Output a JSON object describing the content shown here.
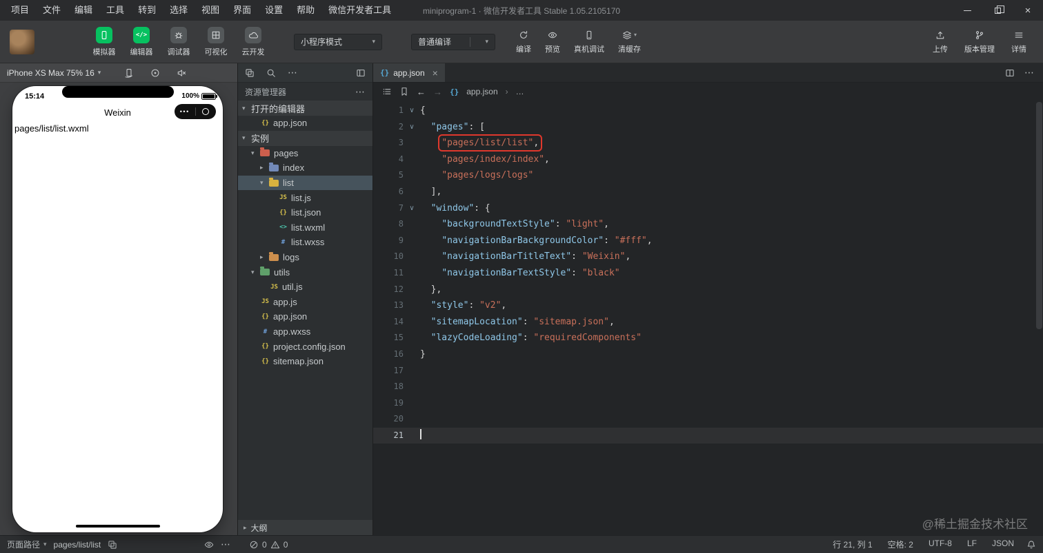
{
  "colors": {
    "accent_green": "#07c160",
    "highlight_red": "#e0382c",
    "json_key": "#8fc7e8",
    "json_string": "#c9705a",
    "tree_selection": "#46535c"
  },
  "menubar": {
    "items": [
      "项目",
      "文件",
      "编辑",
      "工具",
      "转到",
      "选择",
      "视图",
      "界面",
      "设置",
      "帮助",
      "微信开发者工具"
    ],
    "title": "miniprogram-1 · 微信开发者工具 Stable 1.05.2105170"
  },
  "toolbar": {
    "mode_buttons": [
      {
        "label": "模拟器",
        "name": "simulator-toggle-button",
        "icon": "phone-icon",
        "style": "green"
      },
      {
        "label": "编辑器",
        "name": "editor-toggle-button",
        "icon": "code-glyph",
        "style": "green"
      },
      {
        "label": "调试器",
        "name": "debugger-toggle-button",
        "icon": "bug-icon",
        "style": "gray"
      },
      {
        "label": "可视化",
        "name": "visualizer-toggle-button",
        "icon": "grid-icon",
        "style": "gray"
      },
      {
        "label": "云开发",
        "name": "cloud-dev-button",
        "icon": "cloud-icon",
        "style": "gray"
      }
    ],
    "mode_select": {
      "value": "小程序模式"
    },
    "compile_select": {
      "value": "普通编译"
    },
    "action_buttons": [
      {
        "label": "编译",
        "name": "compile-button",
        "icon": "refresh-icon"
      },
      {
        "label": "预览",
        "name": "preview-button",
        "icon": "eye-icon"
      },
      {
        "label": "真机调试",
        "name": "remote-debug-button",
        "icon": "remote-debug-icon"
      },
      {
        "label": "清缓存",
        "name": "clear-cache-button",
        "icon": "clear-cache-icon",
        "caret": true
      }
    ],
    "right_buttons": [
      {
        "label": "上传",
        "name": "upload-button",
        "icon": "upload-icon"
      },
      {
        "label": "版本管理",
        "name": "version-control-button",
        "icon": "branch-icon"
      },
      {
        "label": "详情",
        "name": "details-button",
        "icon": "hamburger-icon"
      }
    ]
  },
  "simulator": {
    "device_label": "iPhone XS Max 75% 16",
    "toolbar_icons": [
      {
        "icon": "rotate-icon",
        "name": "rotate-device-icon"
      },
      {
        "icon": "record-icon",
        "name": "screenshot-icon"
      },
      {
        "icon": "mute-icon",
        "name": "mute-icon"
      }
    ],
    "time": "15:14",
    "battery": "100%",
    "nav_title": "Weixin",
    "page_content": "pages/list/list.wxml"
  },
  "explorer": {
    "title": "资源管理器",
    "strip_icons": [
      {
        "icon": "copy-icon",
        "name": "open-editors-icon"
      },
      {
        "icon": "search-icon",
        "name": "search-icon"
      },
      {
        "glyph": "⋯",
        "name": "explorer-actions-icon"
      },
      {
        "icon": "layout-icon",
        "name": "split-view-icon",
        "right": true
      }
    ],
    "tree": [
      {
        "kind": "section",
        "label": "打开的编辑器",
        "caret": "down"
      },
      {
        "kind": "file",
        "label": "app.json",
        "icon": "json",
        "indent": 1
      },
      {
        "kind": "section",
        "label": "实例",
        "caret": "down"
      },
      {
        "kind": "folder",
        "label": "pages",
        "caret": "down",
        "color": "#cd5f4d",
        "indent": 1
      },
      {
        "kind": "folder",
        "label": "index",
        "caret": "right",
        "color": "#7289b8",
        "indent": 2
      },
      {
        "kind": "folder",
        "label": "list",
        "caret": "down",
        "color": "#d8b23f",
        "indent": 2,
        "selected": true
      },
      {
        "kind": "file",
        "label": "list.js",
        "icon": "js",
        "indent": 3
      },
      {
        "kind": "file",
        "label": "list.json",
        "icon": "json",
        "indent": 3
      },
      {
        "kind": "file",
        "label": "list.wxml",
        "icon": "wxml",
        "indent": 3
      },
      {
        "kind": "file",
        "label": "list.wxss",
        "icon": "wxss",
        "indent": 3
      },
      {
        "kind": "folder",
        "label": "logs",
        "caret": "right",
        "color": "#cd8f4d",
        "indent": 2
      },
      {
        "kind": "folder",
        "label": "utils",
        "caret": "down",
        "color": "#5fa06a",
        "indent": 1
      },
      {
        "kind": "file",
        "label": "util.js",
        "icon": "js",
        "indent": 2
      },
      {
        "kind": "file",
        "label": "app.js",
        "icon": "js",
        "indent": 1
      },
      {
        "kind": "file",
        "label": "app.json",
        "icon": "json",
        "indent": 1
      },
      {
        "kind": "file",
        "label": "app.wxss",
        "icon": "wxss",
        "indent": 1
      },
      {
        "kind": "file",
        "label": "project.config.json",
        "icon": "json",
        "indent": 1
      },
      {
        "kind": "file",
        "label": "sitemap.json",
        "icon": "json",
        "indent": 1
      }
    ],
    "outline": "大纲"
  },
  "editor": {
    "tab": "app.json",
    "breadcrumb_file": "app.json",
    "breadcrumb_more": "…",
    "lines": [
      {
        "n": 1,
        "fold": true,
        "tokens": [
          [
            "p",
            "{"
          ]
        ]
      },
      {
        "n": 2,
        "fold": true,
        "tokens": [
          [
            "p",
            "  "
          ],
          [
            "k",
            "\"pages\""
          ],
          [
            "p",
            ": ["
          ]
        ]
      },
      {
        "n": 3,
        "box": true,
        "tokens": [
          [
            "p",
            "    "
          ],
          [
            "s",
            "\"pages/list/list\""
          ],
          [
            "p",
            ","
          ]
        ]
      },
      {
        "n": 4,
        "tokens": [
          [
            "p",
            "    "
          ],
          [
            "s",
            "\"pages/index/index\""
          ],
          [
            "p",
            ","
          ]
        ]
      },
      {
        "n": 5,
        "tokens": [
          [
            "p",
            "    "
          ],
          [
            "s",
            "\"pages/logs/logs\""
          ]
        ]
      },
      {
        "n": 6,
        "tokens": [
          [
            "p",
            "  ],"
          ]
        ]
      },
      {
        "n": 7,
        "fold": true,
        "tokens": [
          [
            "p",
            "  "
          ],
          [
            "k",
            "\"window\""
          ],
          [
            "p",
            ": {"
          ]
        ]
      },
      {
        "n": 8,
        "tokens": [
          [
            "p",
            "    "
          ],
          [
            "k",
            "\"backgroundTextStyle\""
          ],
          [
            "p",
            ": "
          ],
          [
            "s",
            "\"light\""
          ],
          [
            "p",
            ","
          ]
        ]
      },
      {
        "n": 9,
        "tokens": [
          [
            "p",
            "    "
          ],
          [
            "k",
            "\"navigationBarBackgroundColor\""
          ],
          [
            "p",
            ": "
          ],
          [
            "s",
            "\"#fff\""
          ],
          [
            "p",
            ","
          ]
        ]
      },
      {
        "n": 10,
        "tokens": [
          [
            "p",
            "    "
          ],
          [
            "k",
            "\"navigationBarTitleText\""
          ],
          [
            "p",
            ": "
          ],
          [
            "s",
            "\"Weixin\""
          ],
          [
            "p",
            ","
          ]
        ]
      },
      {
        "n": 11,
        "tokens": [
          [
            "p",
            "    "
          ],
          [
            "k",
            "\"navigationBarTextStyle\""
          ],
          [
            "p",
            ": "
          ],
          [
            "s",
            "\"black\""
          ]
        ]
      },
      {
        "n": 12,
        "tokens": [
          [
            "p",
            "  },"
          ]
        ]
      },
      {
        "n": 13,
        "tokens": [
          [
            "p",
            "  "
          ],
          [
            "k",
            "\"style\""
          ],
          [
            "p",
            ": "
          ],
          [
            "s",
            "\"v2\""
          ],
          [
            "p",
            ","
          ]
        ]
      },
      {
        "n": 14,
        "tokens": [
          [
            "p",
            "  "
          ],
          [
            "k",
            "\"sitemapLocation\""
          ],
          [
            "p",
            ": "
          ],
          [
            "s",
            "\"sitemap.json\""
          ],
          [
            "p",
            ","
          ]
        ]
      },
      {
        "n": 15,
        "tokens": [
          [
            "p",
            "  "
          ],
          [
            "k",
            "\"lazyCodeLoading\""
          ],
          [
            "p",
            ": "
          ],
          [
            "s",
            "\"requiredComponents\""
          ]
        ]
      },
      {
        "n": 16,
        "tokens": [
          [
            "p",
            "}"
          ]
        ]
      },
      {
        "n": 17,
        "tokens": []
      },
      {
        "n": 18,
        "tokens": []
      },
      {
        "n": 19,
        "tokens": []
      },
      {
        "n": 20,
        "tokens": []
      },
      {
        "n": 21,
        "cursor": true,
        "tokens": []
      }
    ]
  },
  "statusbar": {
    "page_path_label": "页面路径",
    "page_path": "pages/list/list",
    "errors": "0",
    "warnings": "0",
    "right_items": [
      {
        "text": "行 21, 列 1",
        "name": "cursor-position-indicator"
      },
      {
        "text": "空格: 2",
        "name": "indent-indicator"
      },
      {
        "text": "UTF-8",
        "name": "encoding-indicator"
      },
      {
        "text": "LF",
        "name": "eol-indicator"
      },
      {
        "text": "JSON",
        "name": "language-indicator"
      }
    ]
  },
  "watermark": "@稀土掘金技术社区"
}
